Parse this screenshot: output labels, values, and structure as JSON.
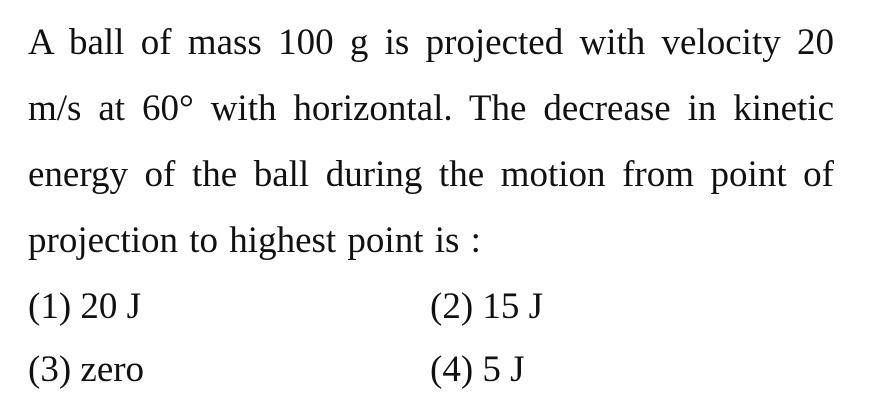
{
  "question": {
    "text": "A ball of mass 100 g is projected with velocity 20 m/s at 60° with horizontal. The decrease in kinetic energy of the ball during the motion from point of projection to highest point is :"
  },
  "options": [
    {
      "label": "(1) 20 J"
    },
    {
      "label": "(2) 15 J"
    },
    {
      "label": "(3) zero"
    },
    {
      "label": "(4) 5 J"
    }
  ]
}
